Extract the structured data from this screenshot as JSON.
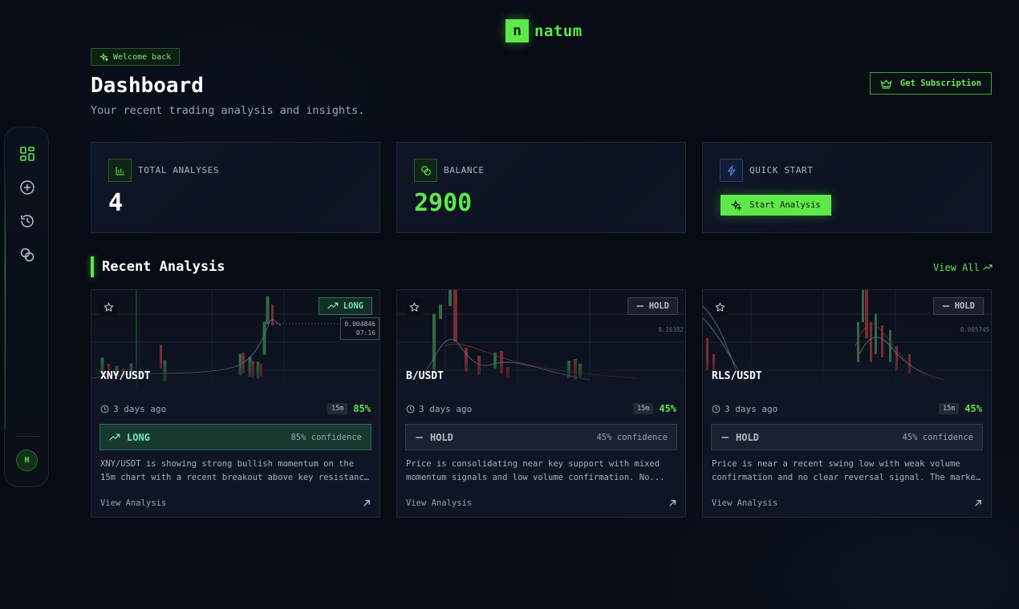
{
  "app": {
    "logo_letter": "n",
    "logo_text": "natum"
  },
  "header": {
    "welcome": "Welcome back",
    "title": "Dashboard",
    "subtitle": "Your recent trading analysis and insights.",
    "subscription_label": "Get Subscription"
  },
  "sidebar": {
    "items": [
      {
        "icon": "dashboard-icon",
        "active": true
      },
      {
        "icon": "plus-circle-icon",
        "active": false
      },
      {
        "icon": "history-icon",
        "active": false
      },
      {
        "icon": "coins-icon",
        "active": false
      }
    ],
    "avatar_initial": "H"
  },
  "stats": {
    "total": {
      "label": "TOTAL ANALYSES",
      "value": "4"
    },
    "balance": {
      "label": "BALANCE",
      "value": "2900"
    },
    "quick": {
      "label": "QUICK START",
      "button": "Start Analysis"
    }
  },
  "recent": {
    "title": "Recent Analysis",
    "view_all": "View All",
    "cards": [
      {
        "pair": "XNY/USDT",
        "badge": "LONG",
        "time_ago": "3 days ago",
        "timeframe": "15m",
        "pct": "85%",
        "signal": "LONG",
        "confidence": "85% confidence",
        "desc1": "XNY/USDT is showing strong bullish momentum on the",
        "desc2": "15m chart with a recent breakout above key resistance...",
        "price": "0.004846",
        "price_time": "07:16",
        "view": "View Analysis"
      },
      {
        "pair": "B/USDT",
        "badge": "HOLD",
        "time_ago": "3 days ago",
        "timeframe": "15m",
        "pct": "45%",
        "signal": "HOLD",
        "confidence": "45% confidence",
        "desc1": "Price is consolidating near key support with mixed",
        "desc2": "momentum signals and low volume confirmation. No...",
        "price": "0.16382",
        "view": "View Analysis"
      },
      {
        "pair": "RLS/USDT",
        "badge": "HOLD",
        "time_ago": "3 days ago",
        "timeframe": "15m",
        "pct": "45%",
        "signal": "HOLD",
        "confidence": "45% confidence",
        "desc1": "Price is near a recent swing low with weak volume",
        "desc2": "confirmation and no clear reversal signal. The market...",
        "price": "0.005745",
        "view": "View Analysis"
      }
    ]
  },
  "colors": {
    "accent": "#5ee84a",
    "long": "#7be3b3",
    "background": "#070b14"
  }
}
